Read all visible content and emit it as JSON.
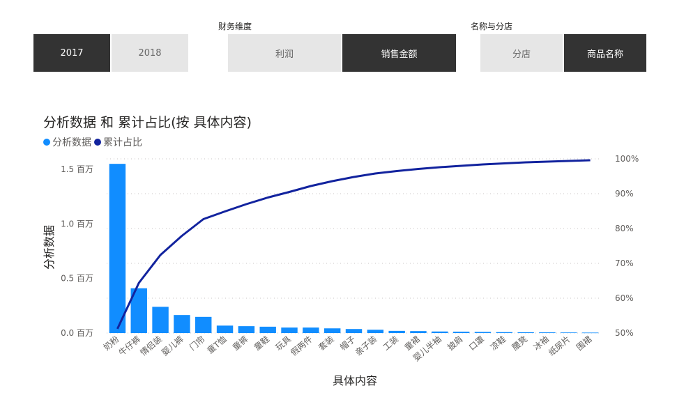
{
  "slicers": [
    {
      "title": "",
      "buttons": [
        {
          "label": "2017",
          "selected": true
        },
        {
          "label": "2018",
          "selected": false
        }
      ]
    },
    {
      "title": "财务维度",
      "buttons": [
        {
          "label": "利润",
          "selected": false
        },
        {
          "label": "销售金额",
          "selected": true
        }
      ]
    },
    {
      "title": "名称与分店",
      "buttons": [
        {
          "label": "分店",
          "selected": false
        },
        {
          "label": "商品名称",
          "selected": true
        }
      ]
    }
  ],
  "colors": {
    "bar": "#118dff",
    "line": "#12239e",
    "selected_bg": "#333333",
    "unselected_bg": "#e6e6e6"
  },
  "chart_data": {
    "type": "bar",
    "title": "分析数据 和 累计占比(按 具体内容)",
    "xlabel": "具体内容",
    "ylabel": "分析数据",
    "ylim": [
      0,
      1.5
    ],
    "y2lim": [
      50,
      100
    ],
    "y_ticks": [
      "0.0 百万",
      "0.5 百万",
      "1.0 百万",
      "1.5 百万"
    ],
    "y2_ticks": [
      "50%",
      "60%",
      "70%",
      "80%",
      "90%",
      "100%"
    ],
    "grid": true,
    "legend_position": "top-left",
    "categories": [
      "奶粉",
      "牛仔裤",
      "情侣装",
      "婴儿裤",
      "门帘",
      "童T恤",
      "童裤",
      "童鞋",
      "玩具",
      "假两件",
      "套装",
      "帽子",
      "亲子装",
      "工装",
      "童裙",
      "婴儿半袖",
      "披肩",
      "口罩",
      "凉鞋",
      "腰凳",
      "冰袖",
      "纸尿片",
      "围裙"
    ],
    "series": [
      {
        "name": "分析数据",
        "type": "bar",
        "axis": "left",
        "values": [
          1.55,
          0.41,
          0.24,
          0.165,
          0.148,
          0.068,
          0.063,
          0.058,
          0.05,
          0.05,
          0.043,
          0.037,
          0.03,
          0.02,
          0.018,
          0.014,
          0.012,
          0.01,
          0.008,
          0.007,
          0.006,
          0.005,
          0.004
        ]
      },
      {
        "name": "累计占比",
        "type": "line",
        "axis": "right",
        "values": [
          51.2,
          64.4,
          72.4,
          77.9,
          82.7,
          84.9,
          87.0,
          88.9,
          90.5,
          92.2,
          93.6,
          94.8,
          95.8,
          96.5,
          97.1,
          97.6,
          98.0,
          98.4,
          98.7,
          99.0,
          99.2,
          99.4,
          99.6
        ]
      }
    ]
  }
}
